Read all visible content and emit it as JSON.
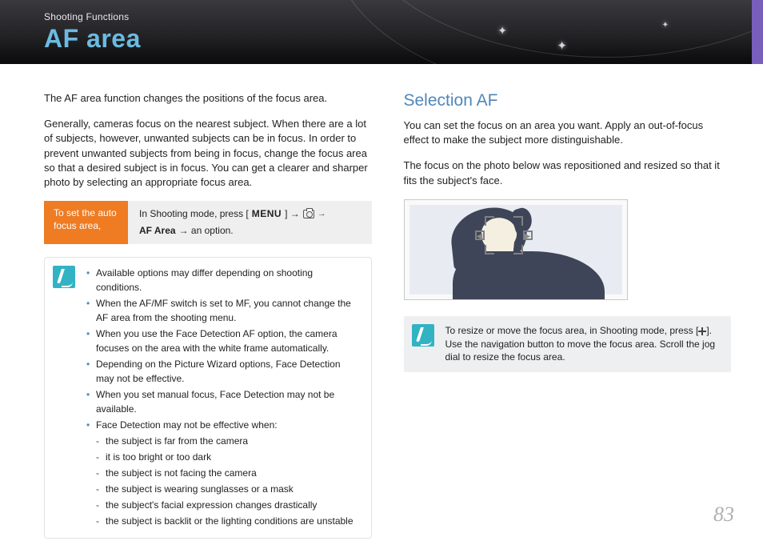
{
  "header": {
    "breadcrumb": "Shooting Functions",
    "title": "AF area"
  },
  "leftCol": {
    "intro1": "The AF area function changes the positions of the focus area.",
    "intro2": "Generally, cameras focus on the nearest subject. When there are a lot of subjects, however, unwanted subjects can be in focus. In order to prevent unwanted subjects from being in focus, change the focus area so that a desired subject is in focus. You can get a clearer and sharper photo by selecting an appropriate focus area.",
    "instruction": {
      "label": "To set the auto focus area,",
      "prefix": "In Shooting mode, press [",
      "menuWord": "MENU",
      "sep1": "] →",
      "sep2": "→",
      "bold": "AF Area",
      "suffix": "→ an option."
    },
    "notes": [
      "Available options may differ depending on shooting conditions.",
      "When the AF/MF switch is set to MF, you cannot change the AF area from the shooting menu.",
      "When you use the Face Detection AF option, the camera focuses on the area with the white frame automatically.",
      "Depending on the Picture Wizard options, Face Detection may not be effective.",
      "When you set manual focus, Face Detection may not be available.",
      "Face Detection may not be effective when:"
    ],
    "subNotes": [
      "the subject is far from the camera",
      "it is too bright or too dark",
      "the subject is not facing the camera",
      "the subject is wearing sunglasses or a mask",
      "the subject's facial expression changes drastically",
      "the subject is backlit or the lighting conditions are unstable"
    ]
  },
  "rightCol": {
    "heading": "Selection AF",
    "p1": "You can set the focus on an area you want. Apply an out-of-focus effect to make the subject more distinguishable.",
    "p2": "The focus on the photo below was repositioned and resized so that it fits the subject's face.",
    "tipPrefix": "To resize or move the focus area, in Shooting mode, press [",
    "tipSuffix": "]. Use the navigation button to move the focus area. Scroll the jog dial to resize the focus area."
  },
  "pageNumber": "83"
}
